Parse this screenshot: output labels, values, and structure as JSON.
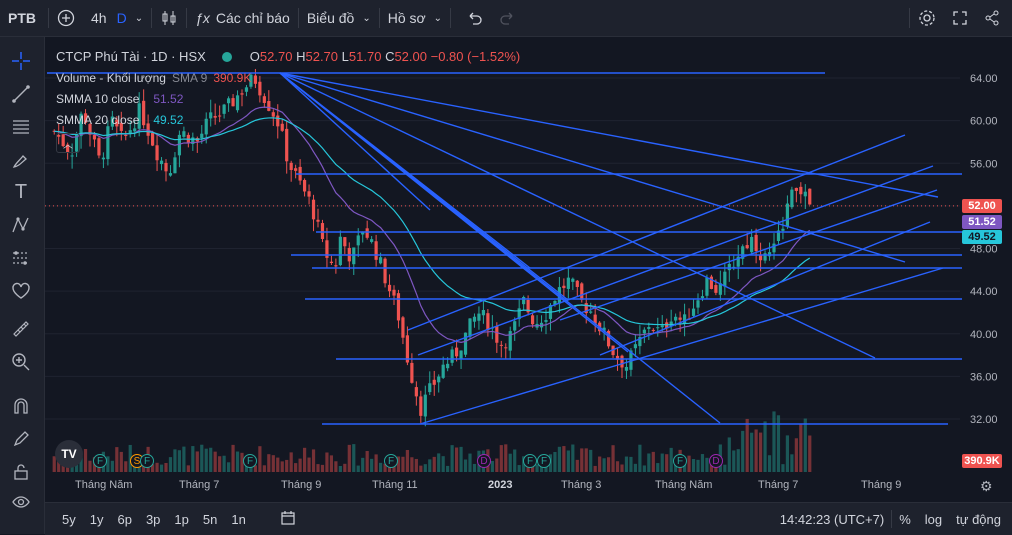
{
  "topbar": {
    "symbol": "PTB",
    "interval": "4h",
    "interval_alt": "D",
    "indicators_label": "Các chỉ báo",
    "chart_label": "Biểu đồ",
    "profile_label": "Hồ sơ"
  },
  "legend": {
    "title": "CTCP Phú Tài · 1D · HSX",
    "o_label": "O",
    "o_value": "52.70",
    "h_label": "H",
    "h_value": "52.70",
    "l_label": "L",
    "l_value": "51.70",
    "c_label": "C",
    "c_value": "52.00",
    "change": "−0.80 (−1.52%)",
    "volume_label": "Volume - Khối lượng",
    "volume_sma": "SMA 9",
    "volume_value": "390.9K",
    "smma10_label": "SMMA 10 close",
    "smma10_value": "51.52",
    "smma20_label": "SMMA 20 close",
    "smma20_value": "49.52"
  },
  "price_axis": [
    "64.00",
    "60.00",
    "56.00",
    "52.00",
    "48.00",
    "44.00",
    "40.00",
    "36.00",
    "32.00"
  ],
  "badges": {
    "last_price": "52.00",
    "smma10": "51.52",
    "smma20": "49.52",
    "volume": "390.9K"
  },
  "time_axis": [
    "Tháng Năm",
    "Tháng 7",
    "Tháng 9",
    "Tháng 11",
    "2023",
    "Tháng 3",
    "Tháng Năm",
    "Tháng 7",
    "Tháng 9"
  ],
  "events": [
    {
      "t": "F",
      "kind": "dividend"
    },
    {
      "t": "",
      "kind": "split"
    },
    {
      "t": "S",
      "kind": "split"
    },
    {
      "t": "F",
      "kind": "dividend"
    },
    {
      "t": "F",
      "kind": "dividend"
    },
    {
      "t": "F",
      "kind": "dividend"
    },
    {
      "t": "D",
      "kind": "earnings"
    },
    {
      "t": "F",
      "kind": "dividend"
    },
    {
      "t": "F",
      "kind": "dividend"
    },
    {
      "t": "F",
      "kind": "dividend"
    },
    {
      "t": "D",
      "kind": "earnings"
    }
  ],
  "bottombar": {
    "ranges": [
      "5y",
      "1y",
      "6p",
      "3p",
      "1p",
      "5n",
      "1n"
    ],
    "time": "14:42:23 (UTC+7)",
    "percent": "%",
    "log": "log",
    "auto": "tự động"
  },
  "colors": {
    "up": "#26a69a",
    "down": "#ef5350",
    "line": "#2962ff",
    "smma10": "#7e57c2",
    "smma20": "#26c6da"
  },
  "chart_data": {
    "type": "candlestick",
    "title": "CTCP Phú Tài · 1D · HSX",
    "ylim": [
      30,
      66
    ],
    "close_path": [
      [
        0,
        59
      ],
      [
        3,
        57
      ],
      [
        5,
        61
      ],
      [
        8,
        56
      ],
      [
        10,
        60
      ],
      [
        12,
        58
      ],
      [
        15,
        61
      ],
      [
        18,
        57
      ],
      [
        20,
        55
      ],
      [
        22,
        59
      ],
      [
        25,
        58
      ],
      [
        27,
        60
      ],
      [
        30,
        61
      ],
      [
        33,
        63
      ],
      [
        35,
        64
      ],
      [
        37,
        62
      ],
      [
        39,
        60
      ],
      [
        41,
        56
      ],
      [
        43,
        54
      ],
      [
        45,
        52
      ],
      [
        47,
        48
      ],
      [
        49,
        46
      ],
      [
        50,
        49
      ],
      [
        52,
        47
      ],
      [
        54,
        50
      ],
      [
        56,
        48
      ],
      [
        58,
        45
      ],
      [
        60,
        42
      ],
      [
        62,
        37
      ],
      [
        64,
        33
      ],
      [
        66,
        35
      ],
      [
        68,
        37
      ],
      [
        70,
        38
      ],
      [
        72,
        40
      ],
      [
        74,
        42
      ],
      [
        76,
        41
      ],
      [
        78,
        39
      ],
      [
        80,
        40
      ],
      [
        82,
        43
      ],
      [
        84,
        41
      ],
      [
        86,
        42
      ],
      [
        88,
        44
      ],
      [
        90,
        45
      ],
      [
        92,
        43
      ],
      [
        94,
        42
      ],
      [
        96,
        40
      ],
      [
        98,
        38
      ],
      [
        100,
        37
      ],
      [
        102,
        39
      ],
      [
        104,
        41
      ],
      [
        106,
        40
      ],
      [
        108,
        42
      ],
      [
        110,
        41
      ],
      [
        112,
        43
      ],
      [
        114,
        45
      ],
      [
        116,
        44
      ],
      [
        118,
        46
      ],
      [
        120,
        48
      ],
      [
        122,
        49
      ],
      [
        124,
        47
      ],
      [
        126,
        48
      ],
      [
        128,
        52
      ],
      [
        130,
        54
      ],
      [
        132,
        52
      ]
    ]
  }
}
